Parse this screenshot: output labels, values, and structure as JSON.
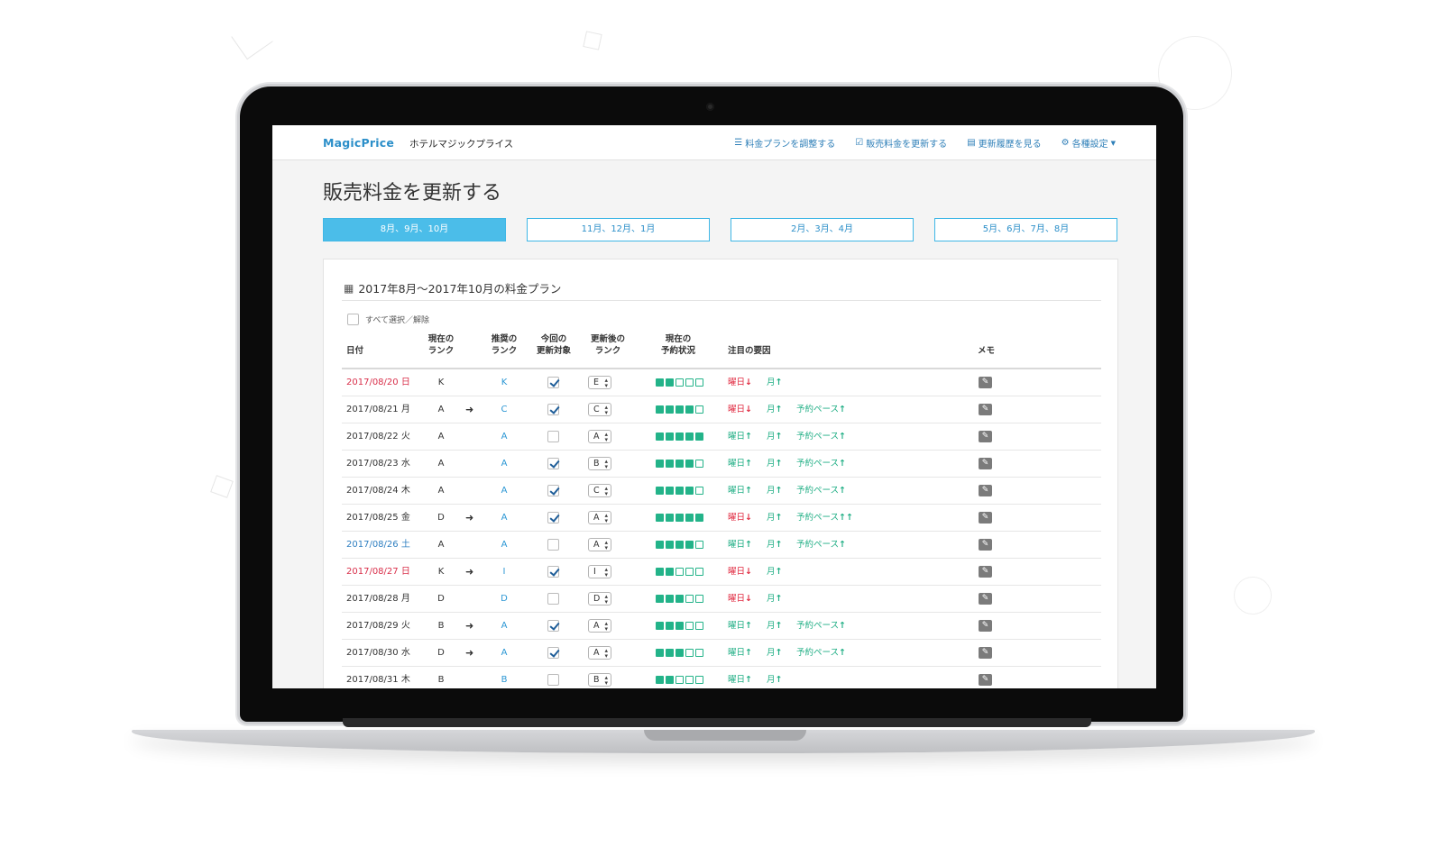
{
  "app": {
    "brand": "MagicPrice",
    "hotel_name": "ホテルマジックプライス"
  },
  "nav": [
    {
      "label": "料金プランを調整する",
      "icon": "sliders-icon"
    },
    {
      "label": "販売料金を更新する",
      "icon": "check-square-icon"
    },
    {
      "label": "更新履歴を見る",
      "icon": "document-icon"
    },
    {
      "label": "各種設定",
      "icon": "gear-icon",
      "dropdown": true
    }
  ],
  "page_title": "販売料金を更新する",
  "period_tabs": [
    {
      "label": "8月、9月、10月",
      "active": true
    },
    {
      "label": "11月、12月、1月",
      "active": false
    },
    {
      "label": "2月、3月、4月",
      "active": false
    },
    {
      "label": "5月、6月、7月、8月",
      "active": false
    }
  ],
  "panel": {
    "title": "2017年8月〜2017年10月の料金プラン",
    "select_all_label": "すべて選択／解除"
  },
  "columns": {
    "date": "日付",
    "current_rank_1": "現在の",
    "current_rank_2": "ランク",
    "recommended_rank_1": "推奨の",
    "recommended_rank_2": "ランク",
    "target_1": "今回の",
    "target_2": "更新対象",
    "new_rank_1": "更新後の",
    "new_rank_2": "ランク",
    "booking_1": "現在の",
    "booking_2": "予約状況",
    "factors": "注目の要因",
    "memo": "メモ"
  },
  "rows": [
    {
      "date": "2017/08/20 日",
      "day_type": "sun",
      "current": "K",
      "arrow": false,
      "recommended": "K",
      "checked": true,
      "new_rank": "E",
      "booking": 2,
      "factors": [
        {
          "label": "曜日",
          "dir": "down"
        },
        {
          "label": "月",
          "dir": "up"
        }
      ]
    },
    {
      "date": "2017/08/21 月",
      "day_type": "weekday",
      "current": "A",
      "arrow": true,
      "recommended": "C",
      "checked": true,
      "new_rank": "C",
      "booking": 4,
      "factors": [
        {
          "label": "曜日",
          "dir": "down"
        },
        {
          "label": "月",
          "dir": "up"
        },
        {
          "label": "予約ペース",
          "dir": "up"
        }
      ]
    },
    {
      "date": "2017/08/22 火",
      "day_type": "weekday",
      "current": "A",
      "arrow": false,
      "recommended": "A",
      "checked": false,
      "new_rank": "A",
      "booking": 5,
      "factors": [
        {
          "label": "曜日",
          "dir": "up"
        },
        {
          "label": "月",
          "dir": "up"
        },
        {
          "label": "予約ペース",
          "dir": "up"
        }
      ]
    },
    {
      "date": "2017/08/23 水",
      "day_type": "weekday",
      "current": "A",
      "arrow": false,
      "recommended": "A",
      "checked": true,
      "new_rank": "B",
      "booking": 4,
      "factors": [
        {
          "label": "曜日",
          "dir": "up"
        },
        {
          "label": "月",
          "dir": "up"
        },
        {
          "label": "予約ペース",
          "dir": "up"
        }
      ]
    },
    {
      "date": "2017/08/24 木",
      "day_type": "weekday",
      "current": "A",
      "arrow": false,
      "recommended": "A",
      "checked": true,
      "new_rank": "C",
      "booking": 4,
      "factors": [
        {
          "label": "曜日",
          "dir": "up"
        },
        {
          "label": "月",
          "dir": "up"
        },
        {
          "label": "予約ペース",
          "dir": "up"
        }
      ]
    },
    {
      "date": "2017/08/25 金",
      "day_type": "weekday",
      "current": "D",
      "arrow": true,
      "recommended": "A",
      "checked": true,
      "new_rank": "A",
      "booking": 5,
      "factors": [
        {
          "label": "曜日",
          "dir": "down"
        },
        {
          "label": "月",
          "dir": "up"
        },
        {
          "label": "予約ペース",
          "dir": "up2"
        }
      ]
    },
    {
      "date": "2017/08/26 土",
      "day_type": "sat",
      "current": "A",
      "arrow": false,
      "recommended": "A",
      "checked": false,
      "new_rank": "A",
      "booking": 4,
      "factors": [
        {
          "label": "曜日",
          "dir": "up"
        },
        {
          "label": "月",
          "dir": "up"
        },
        {
          "label": "予約ペース",
          "dir": "up"
        }
      ]
    },
    {
      "date": "2017/08/27 日",
      "day_type": "sun",
      "current": "K",
      "arrow": true,
      "recommended": "I",
      "checked": true,
      "new_rank": "I",
      "booking": 2,
      "factors": [
        {
          "label": "曜日",
          "dir": "down"
        },
        {
          "label": "月",
          "dir": "up"
        }
      ]
    },
    {
      "date": "2017/08/28 月",
      "day_type": "weekday",
      "current": "D",
      "arrow": false,
      "recommended": "D",
      "checked": false,
      "new_rank": "D",
      "booking": 3,
      "factors": [
        {
          "label": "曜日",
          "dir": "down"
        },
        {
          "label": "月",
          "dir": "up"
        }
      ]
    },
    {
      "date": "2017/08/29 火",
      "day_type": "weekday",
      "current": "B",
      "arrow": true,
      "recommended": "A",
      "checked": true,
      "new_rank": "A",
      "booking": 3,
      "factors": [
        {
          "label": "曜日",
          "dir": "up"
        },
        {
          "label": "月",
          "dir": "up"
        },
        {
          "label": "予約ペース",
          "dir": "up"
        }
      ]
    },
    {
      "date": "2017/08/30 水",
      "day_type": "weekday",
      "current": "D",
      "arrow": true,
      "recommended": "A",
      "checked": true,
      "new_rank": "A",
      "booking": 3,
      "factors": [
        {
          "label": "曜日",
          "dir": "up"
        },
        {
          "label": "月",
          "dir": "up"
        },
        {
          "label": "予約ペース",
          "dir": "up"
        }
      ]
    },
    {
      "date": "2017/08/31 木",
      "day_type": "weekday",
      "current": "B",
      "arrow": false,
      "recommended": "B",
      "checked": false,
      "new_rank": "B",
      "booking": 2,
      "factors": [
        {
          "label": "曜日",
          "dir": "up"
        },
        {
          "label": "月",
          "dir": "up"
        }
      ]
    }
  ],
  "colors": {
    "accent": "#4bbde9",
    "brand": "#2c8fc9",
    "up": "#1fae84",
    "down": "#e0283f",
    "sunday": "#d9304b",
    "saturday": "#2f7fc1"
  }
}
